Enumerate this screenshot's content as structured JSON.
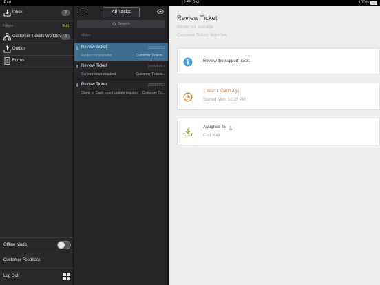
{
  "status_bar": {
    "carrier": "iPad",
    "time": "12:55 PM",
    "battery": "100%"
  },
  "sidebar": {
    "inbox": {
      "label": "Inbox",
      "count": "3"
    },
    "filters_label": "Filters",
    "edit_label": "Edit",
    "items": [
      {
        "label": "Customer Tickets Workflow",
        "count": "3",
        "icon": "workflow-icon"
      },
      {
        "label": "Outbox",
        "icon": "outbox-icon"
      },
      {
        "label": "Forms",
        "icon": "forms-icon"
      }
    ],
    "offline_mode": "Offline Mode",
    "customer_feedback": "Customer Feedback",
    "log_out": "Log Out"
  },
  "list": {
    "title": "All Tasks",
    "search_placeholder": "Search",
    "section": "Older",
    "tasks": [
      {
        "title": "Review Ticket",
        "date": "2015/07/13",
        "subtitle": "Printer not available",
        "workflow": "Customer Tickets...",
        "selected": true
      },
      {
        "title": "Review Ticket",
        "date": "2015/07/13",
        "subtitle": "Server reboot required",
        "workflow": "Customer Tickets...",
        "selected": false
      },
      {
        "title": "Review Ticket",
        "date": "2015/07/13",
        "subtitle": "Quote to Cash report update required",
        "workflow": "Customer Tic...",
        "selected": false
      }
    ]
  },
  "detail": {
    "title": "Review Ticket",
    "subtitle": "Printer not available",
    "workflow": "Customer Tickets Workflow",
    "info": "Review the support ticket.",
    "elapsed": "1 Year 1 Month Ago",
    "started": "Started Mon, 10:39 PM",
    "assigned_label": "Assigned To",
    "assignee": "Codi Kaji"
  },
  "colors": {
    "accent_selected": "#3e6e8e",
    "edit_link": "#c8b820",
    "elapsed_orange": "#e87722",
    "info_blue": "#4a9fd8",
    "assigned_olive": "#a8a020"
  }
}
